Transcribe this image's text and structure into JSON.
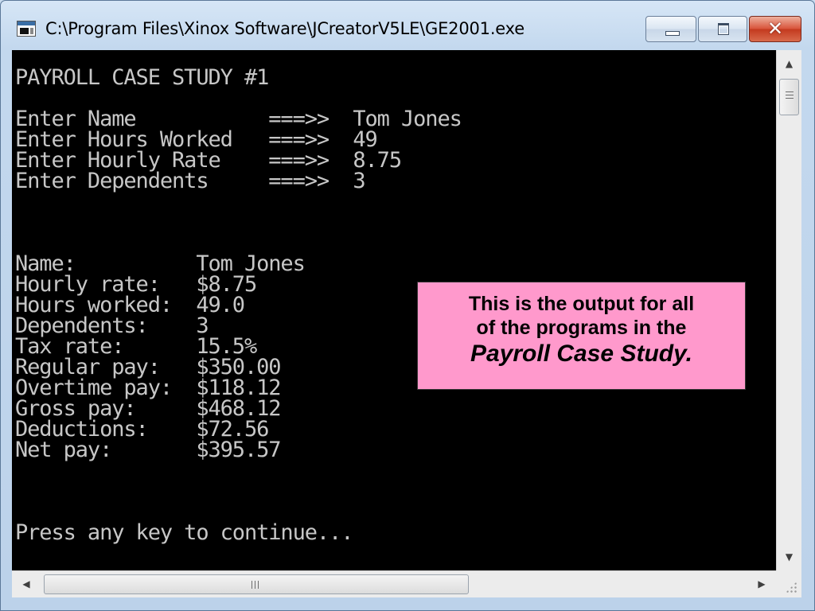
{
  "window": {
    "title": "C:\\Program Files\\Xinox Software\\JCreatorV5LE\\GE2001.exe",
    "icon": "console-app-icon",
    "controls": {
      "minimize": "minimize-icon",
      "maximize": "maximize-icon",
      "close_glyph": "✕"
    }
  },
  "console": {
    "lines": [
      "PAYROLL CASE STUDY #1",
      "",
      "Enter Name           ===>>  Tom Jones",
      "Enter Hours Worked   ===>>  49",
      "Enter Hourly Rate    ===>>  8.75",
      "Enter Dependents     ===>>  3",
      "",
      "",
      "",
      "Name:          Tom Jones",
      "Hourly rate:   $8.75",
      "Hours worked:  49.0",
      "Dependents:    3",
      "Tax rate:      15.5%",
      "Regular pay:   $350.00",
      "Overtime pay:  $118.12",
      "Gross pay:     $468.12",
      "Deductions:    $72.56",
      "Net pay:       $395.57",
      "",
      "",
      "",
      "Press any key to continue..."
    ]
  },
  "callout": {
    "line1": "This is the output for all",
    "line2": "of the programs in the",
    "line3": "Payroll Case Study."
  },
  "scrollbars": {
    "up_glyph": "▲",
    "down_glyph": "▼",
    "left_glyph": "◀",
    "right_glyph": "▶"
  },
  "colors": {
    "console_bg": "#000000",
    "console_fg": "#c7c7c7",
    "callout_bg": "#ff99cc"
  }
}
